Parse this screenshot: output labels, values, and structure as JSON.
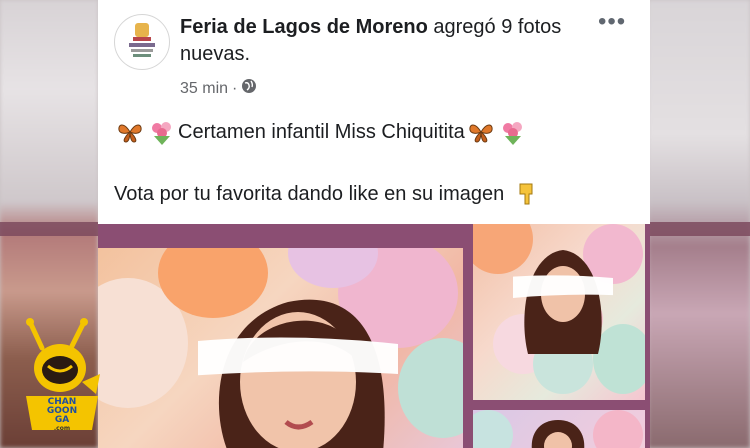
{
  "post": {
    "page_name": "Feria de Lagos de Moreno",
    "action_text": " agregó 9 fotos nuevas.",
    "time": "35 min",
    "separator": "·",
    "privacy_icon": "globe-icon",
    "more_label": "•••",
    "line1_text": "Certamen infantil Miss Chiquitita",
    "line2_text": "Vota por tu favorita dando like en su imagen",
    "emojis": [
      "butterfly-icon",
      "bouquet-icon",
      "pointing-down-icon"
    ]
  },
  "watermark": {
    "line1": "CHAN",
    "line2": "GOON",
    "line3": "GA",
    "suffix": ".com"
  },
  "colors": {
    "text": "#1c1e21",
    "meta": "#65676b",
    "photo_frame": "#8b4e73",
    "logo_yellow": "#f4c400"
  }
}
